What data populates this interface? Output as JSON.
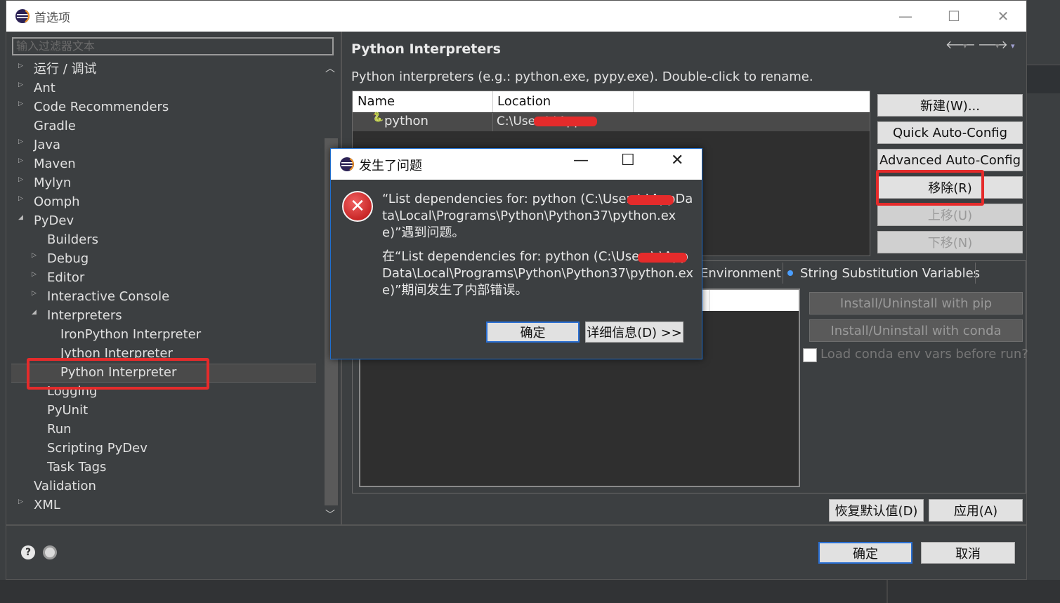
{
  "window": {
    "title": "首选项",
    "minimize": "—",
    "maximize": "☐",
    "close": "✕"
  },
  "filter_placeholder": "输入过滤器文本",
  "tree": [
    {
      "label": "运行 / 调试",
      "depth": 0,
      "arrow": "▷"
    },
    {
      "label": "Ant",
      "depth": 0,
      "arrow": "▷"
    },
    {
      "label": "Code Recommenders",
      "depth": 0,
      "arrow": "▷"
    },
    {
      "label": "Gradle",
      "depth": 0,
      "arrow": ""
    },
    {
      "label": "Java",
      "depth": 0,
      "arrow": "▷"
    },
    {
      "label": "Maven",
      "depth": 0,
      "arrow": "▷"
    },
    {
      "label": "Mylyn",
      "depth": 0,
      "arrow": "▷"
    },
    {
      "label": "Oomph",
      "depth": 0,
      "arrow": "▷"
    },
    {
      "label": "PyDev",
      "depth": 0,
      "arrow": "◢"
    },
    {
      "label": "Builders",
      "depth": 1,
      "arrow": ""
    },
    {
      "label": "Debug",
      "depth": 1,
      "arrow": "▷"
    },
    {
      "label": "Editor",
      "depth": 1,
      "arrow": "▷"
    },
    {
      "label": "Interactive Console",
      "depth": 1,
      "arrow": "▷"
    },
    {
      "label": "Interpreters",
      "depth": 1,
      "arrow": "◢"
    },
    {
      "label": "IronPython Interpreter",
      "depth": 2,
      "arrow": ""
    },
    {
      "label": "Jython Interpreter",
      "depth": 2,
      "arrow": ""
    },
    {
      "label": "Python Interpreter",
      "depth": 2,
      "arrow": ""
    },
    {
      "label": "Logging",
      "depth": 1,
      "arrow": ""
    },
    {
      "label": "PyUnit",
      "depth": 1,
      "arrow": ""
    },
    {
      "label": "Run",
      "depth": 1,
      "arrow": ""
    },
    {
      "label": "Scripting PyDev",
      "depth": 1,
      "arrow": ""
    },
    {
      "label": "Task Tags",
      "depth": 1,
      "arrow": ""
    },
    {
      "label": "Validation",
      "depth": 0,
      "arrow": ""
    },
    {
      "label": "XML",
      "depth": 0,
      "arrow": "▷"
    }
  ],
  "scroll": {
    "up": "︿",
    "down": "﹀"
  },
  "page": {
    "title": "Python Interpreters",
    "nav_back": "🡐",
    "nav_fwd": "🡒",
    "nav_drop": "▾",
    "description": "Python interpreters (e.g.: python.exe, pypy.exe).   Double-click to rename.",
    "table_headers": [
      "Name",
      "Location"
    ],
    "rows": [
      {
        "name": "python",
        "location": "C:\\Users\\      \\App..."
      }
    ]
  },
  "side_buttons": {
    "new": "新建(W)...",
    "quick": "Quick Auto-Config",
    "advanced": "Advanced Auto-Config",
    "remove": "移除(R)",
    "up": "上移(U)",
    "down": "下移(N)"
  },
  "tabs": {
    "env": "Environment",
    "string_sub": "String Substitution Variables"
  },
  "pip_button": "Install/Uninstall with pip",
  "conda_button": "Install/Uninstall with conda",
  "conda_check": "Load conda env vars before run?",
  "restore_button": "恢复默认值(D)",
  "apply_button": "应用(A)",
  "ok_button": "确定",
  "cancel_button": "取消",
  "footer": {
    "help": "?"
  },
  "dialog": {
    "title": "发生了问题",
    "minimize": "—",
    "maximize": "☐",
    "close": "✕",
    "msg1": "“List dependencies for: python  (C:\\Users\\                \\AppData\\Local\\Programs\\Python\\Python37\\python.exe)”遇到问题。",
    "msg2": "在“List dependencies for: python  (C:\\Users\\                \\AppData\\Local\\Programs\\Python\\Python37\\python.exe)”期间发生了内部错误。",
    "ok": "确定",
    "details": "详细信息(D) >>"
  }
}
